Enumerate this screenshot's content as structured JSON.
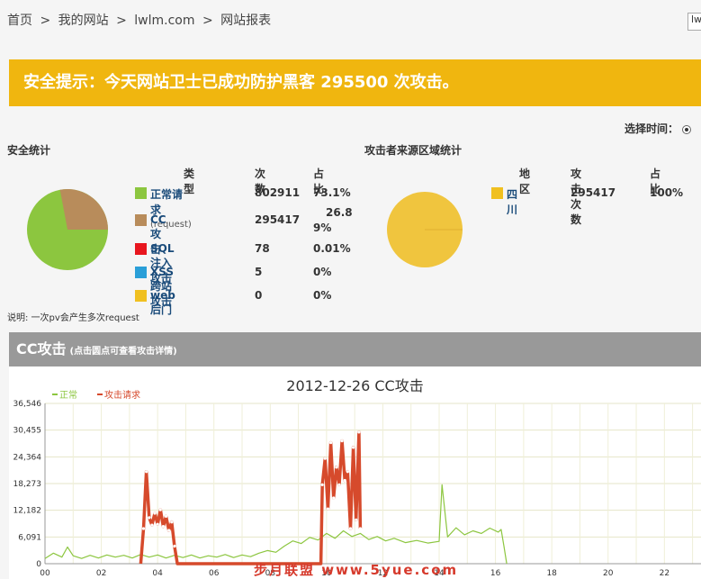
{
  "breadcrumb": {
    "items": [
      "首页",
      ">",
      "我的网站",
      ">",
      "lwlm.com",
      ">",
      "网站报表"
    ]
  },
  "top_input": {
    "value": "lw"
  },
  "alert": {
    "text": "安全提示：今天网站卫士已成功防护黑客 295500 次攻击。"
  },
  "time_select": {
    "label": "选择时间："
  },
  "security_stats": {
    "title": "安全统计",
    "headers": {
      "type": "类型",
      "count": "次数",
      "ratio": "占比"
    },
    "rows": [
      {
        "type": "正常请求",
        "suffix": "(request)",
        "count": "802911",
        "ratio": "73.1%",
        "color": "#8cc63f"
      },
      {
        "type": "CC攻击",
        "suffix": "",
        "count": "295417",
        "ratio": "26.8",
        "ratio2": "9%",
        "color": "#b88c5b"
      },
      {
        "type": "SQL注入攻击",
        "suffix": "",
        "count": "78",
        "ratio": "0.01%",
        "color": "#e8161e"
      },
      {
        "type": "XSS跨站攻击",
        "suffix": "",
        "count": "5",
        "ratio": "0%",
        "color": "#2a9fd8"
      },
      {
        "type": "web后门",
        "suffix": "",
        "count": "0",
        "ratio": "0%",
        "color": "#f0c020"
      }
    ],
    "note": "说明: 一次pv会产生多次request"
  },
  "region_stats": {
    "title": "攻击者来源区域统计",
    "headers": {
      "region": "地区",
      "count": "攻击次数",
      "ratio": "占比"
    },
    "rows": [
      {
        "region": "四川",
        "count": "295417",
        "ratio": "100%",
        "color": "#f0c020"
      }
    ]
  },
  "cc_section": {
    "title": "CC攻击",
    "subtitle": "(点击圆点可查看攻击详情)"
  },
  "chart_data": {
    "type": "line",
    "title": "2012-12-26 CC攻击",
    "legend": [
      "正常",
      "攻击请求"
    ],
    "ylim": [
      0,
      36546
    ],
    "y_ticks": [
      "0",
      "6,091",
      "12,182",
      "18,273",
      "24,364",
      "30,455",
      "36,546"
    ],
    "x_ticks": [
      "00",
      "02",
      "04",
      "06",
      "08",
      "10",
      "12",
      "14",
      "16",
      "18",
      "20",
      "22"
    ],
    "xlim": [
      0,
      23.3
    ],
    "series": [
      {
        "name": "正常",
        "color": "#8cc63f",
        "points": [
          [
            0,
            1200
          ],
          [
            0.3,
            2400
          ],
          [
            0.6,
            1500
          ],
          [
            0.8,
            3800
          ],
          [
            1.0,
            1800
          ],
          [
            1.3,
            1200
          ],
          [
            1.6,
            1900
          ],
          [
            1.9,
            1300
          ],
          [
            2.2,
            2000
          ],
          [
            2.5,
            1500
          ],
          [
            2.8,
            1900
          ],
          [
            3.1,
            1300
          ],
          [
            3.4,
            2100
          ],
          [
            3.7,
            1500
          ],
          [
            4.0,
            2000
          ],
          [
            4.3,
            1300
          ],
          [
            4.6,
            1900
          ],
          [
            4.9,
            1400
          ],
          [
            5.2,
            2000
          ],
          [
            5.5,
            1300
          ],
          [
            5.8,
            1800
          ],
          [
            6.1,
            1500
          ],
          [
            6.4,
            2100
          ],
          [
            6.7,
            1400
          ],
          [
            7.0,
            2000
          ],
          [
            7.3,
            1600
          ],
          [
            7.6,
            2400
          ],
          [
            7.9,
            3000
          ],
          [
            8.2,
            2600
          ],
          [
            8.5,
            4000
          ],
          [
            8.8,
            5200
          ],
          [
            9.1,
            4600
          ],
          [
            9.4,
            6000
          ],
          [
            9.7,
            5400
          ],
          [
            10.0,
            6900
          ],
          [
            10.3,
            5800
          ],
          [
            10.6,
            7500
          ],
          [
            10.9,
            6200
          ],
          [
            11.2,
            6900
          ],
          [
            11.5,
            5500
          ],
          [
            11.8,
            6200
          ],
          [
            12.1,
            5200
          ],
          [
            12.4,
            5800
          ],
          [
            12.8,
            4800
          ],
          [
            13.2,
            5300
          ],
          [
            13.6,
            4700
          ],
          [
            14.0,
            5100
          ],
          [
            14.1,
            18000
          ],
          [
            14.3,
            6100
          ],
          [
            14.6,
            8200
          ],
          [
            14.9,
            6600
          ],
          [
            15.2,
            7500
          ],
          [
            15.5,
            6900
          ],
          [
            15.8,
            8100
          ],
          [
            16.1,
            7200
          ],
          [
            16.2,
            7800
          ],
          [
            16.3,
            4000
          ],
          [
            16.4,
            0
          ]
        ]
      },
      {
        "name": "攻击请求",
        "color": "#d64a2c",
        "points": [
          [
            3.4,
            0
          ],
          [
            3.5,
            8000
          ],
          [
            3.6,
            21000
          ],
          [
            3.7,
            10500
          ],
          [
            3.8,
            8800
          ],
          [
            3.9,
            11500
          ],
          [
            4.0,
            9000
          ],
          [
            4.1,
            12300
          ],
          [
            4.2,
            8500
          ],
          [
            4.3,
            10800
          ],
          [
            4.4,
            7600
          ],
          [
            4.5,
            9500
          ],
          [
            4.6,
            4000
          ],
          [
            4.7,
            0
          ],
          [
            9.8,
            0
          ],
          [
            9.85,
            18000
          ],
          [
            9.95,
            24000
          ],
          [
            10.05,
            12500
          ],
          [
            10.15,
            27600
          ],
          [
            10.25,
            15000
          ],
          [
            10.35,
            22000
          ],
          [
            10.45,
            18000
          ],
          [
            10.55,
            28000
          ],
          [
            10.65,
            19000
          ],
          [
            10.75,
            21000
          ],
          [
            10.85,
            8000
          ],
          [
            10.95,
            26500
          ],
          [
            11.05,
            10000
          ],
          [
            11.15,
            30000
          ],
          [
            11.2,
            8000
          ]
        ]
      }
    ]
  },
  "watermark": "步月联盟  www.5yue.com"
}
